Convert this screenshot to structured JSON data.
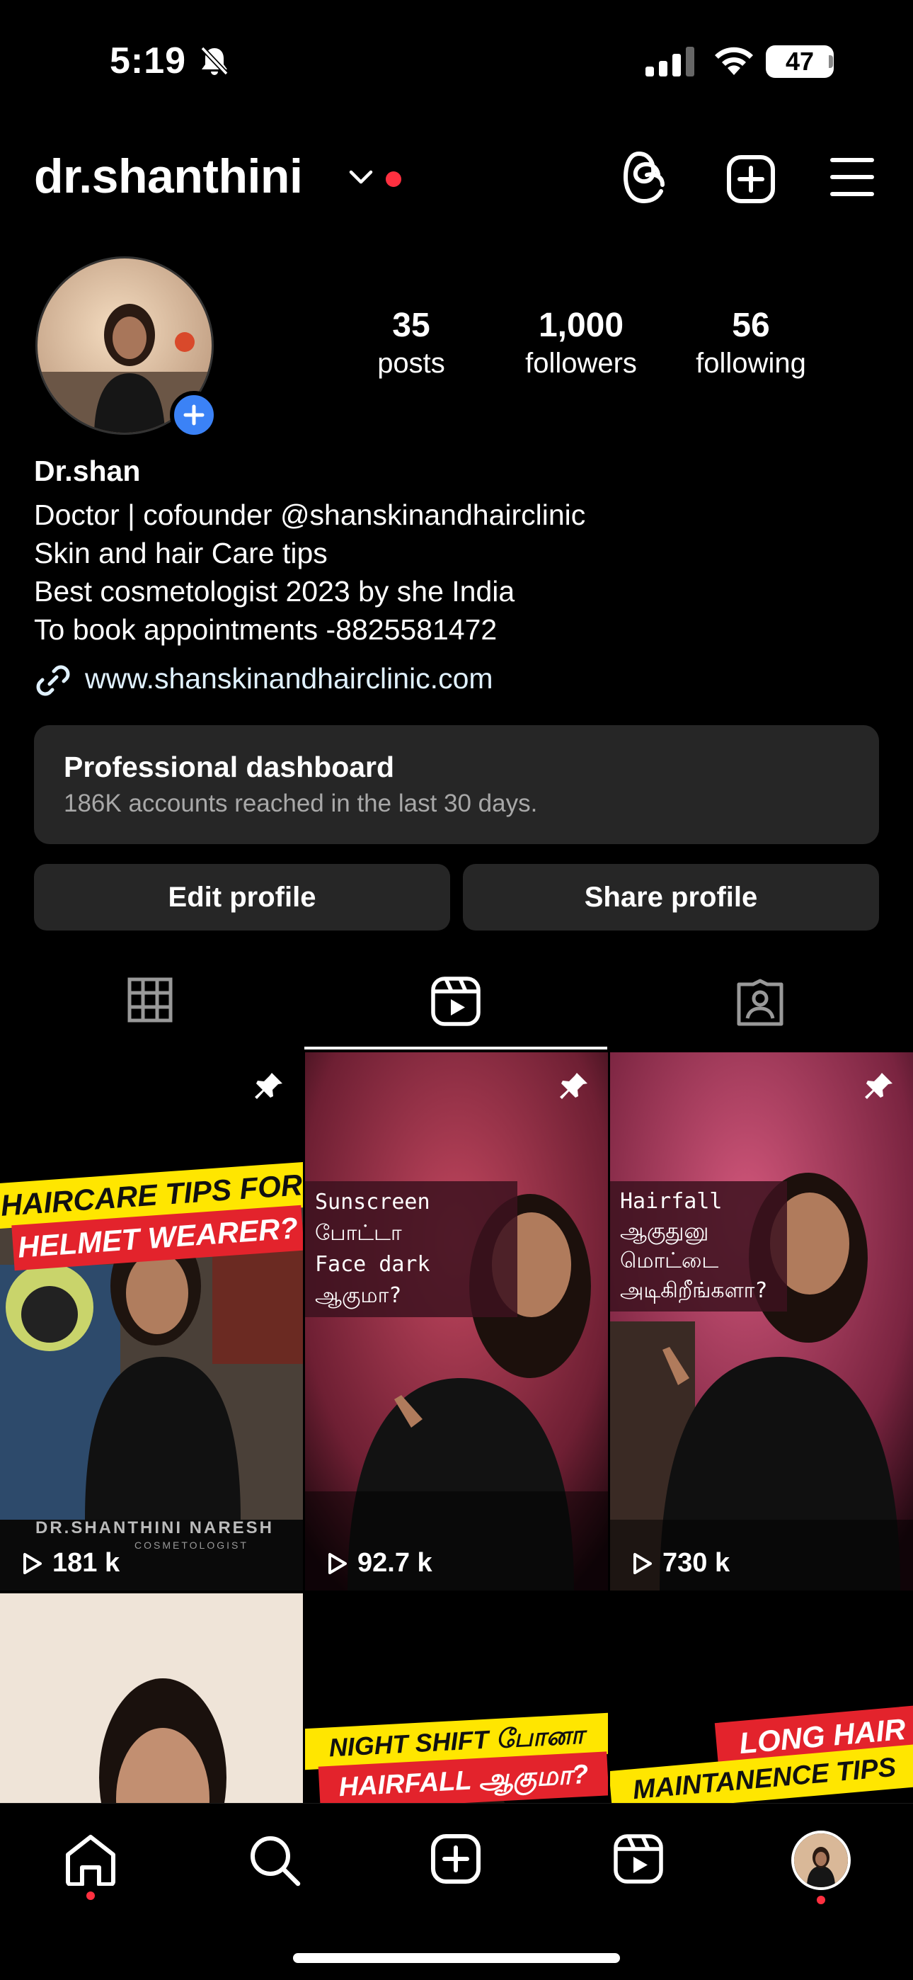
{
  "status_bar": {
    "time": "5:19",
    "battery": "47"
  },
  "header": {
    "username": "dr.shanthini"
  },
  "profile": {
    "stats": [
      {
        "value": "35",
        "label": "posts"
      },
      {
        "value": "1,000",
        "label": "followers"
      },
      {
        "value": "56",
        "label": "following"
      }
    ],
    "display_name": "Dr.shan",
    "bio": [
      "Doctor | cofounder @shanskinandhairclinic",
      "Skin and hair Care tips",
      "Best cosmetologist 2023 by she India",
      "To book appointments -8825581472"
    ],
    "website": "www.shanskinandhairclinic.com"
  },
  "dashboard": {
    "title": "Professional dashboard",
    "subtitle": "186K accounts reached in the last 30 days."
  },
  "buttons": {
    "edit": "Edit profile",
    "share": "Share profile"
  },
  "tabs": {
    "active": "reels"
  },
  "reels": [
    {
      "views": "181 k",
      "pinned": true,
      "line1": "HAIRCARE TIPS FOR",
      "line2": "HELMET WEARER?",
      "watermark": "DR.SHANTHINI NARESH",
      "watermark_sub": "COSMETOLOGIST"
    },
    {
      "views": "92.7 k",
      "pinned": true,
      "caption1": "Sunscreen போட்டா",
      "caption2": "Face dark ஆகுமா?"
    },
    {
      "views": "730 k",
      "pinned": true,
      "caption1": "Hairfall ஆகுதுனு",
      "caption2": "மொட்டை",
      "caption3": "அடிகிறீங்களா?"
    },
    {},
    {
      "line1": "NIGHT SHIFT போனா",
      "line2": "HAIRFALL ஆகுமா?"
    },
    {
      "line1": "LONG HAIR",
      "line2": "MAINTANENCE TIPS"
    }
  ],
  "colors": {
    "accent_blue": "#3b82f6",
    "notification_red": "#ff3040",
    "card_bg": "#262626",
    "banner_yellow": "#ffe600",
    "banner_red": "#e3232c"
  }
}
